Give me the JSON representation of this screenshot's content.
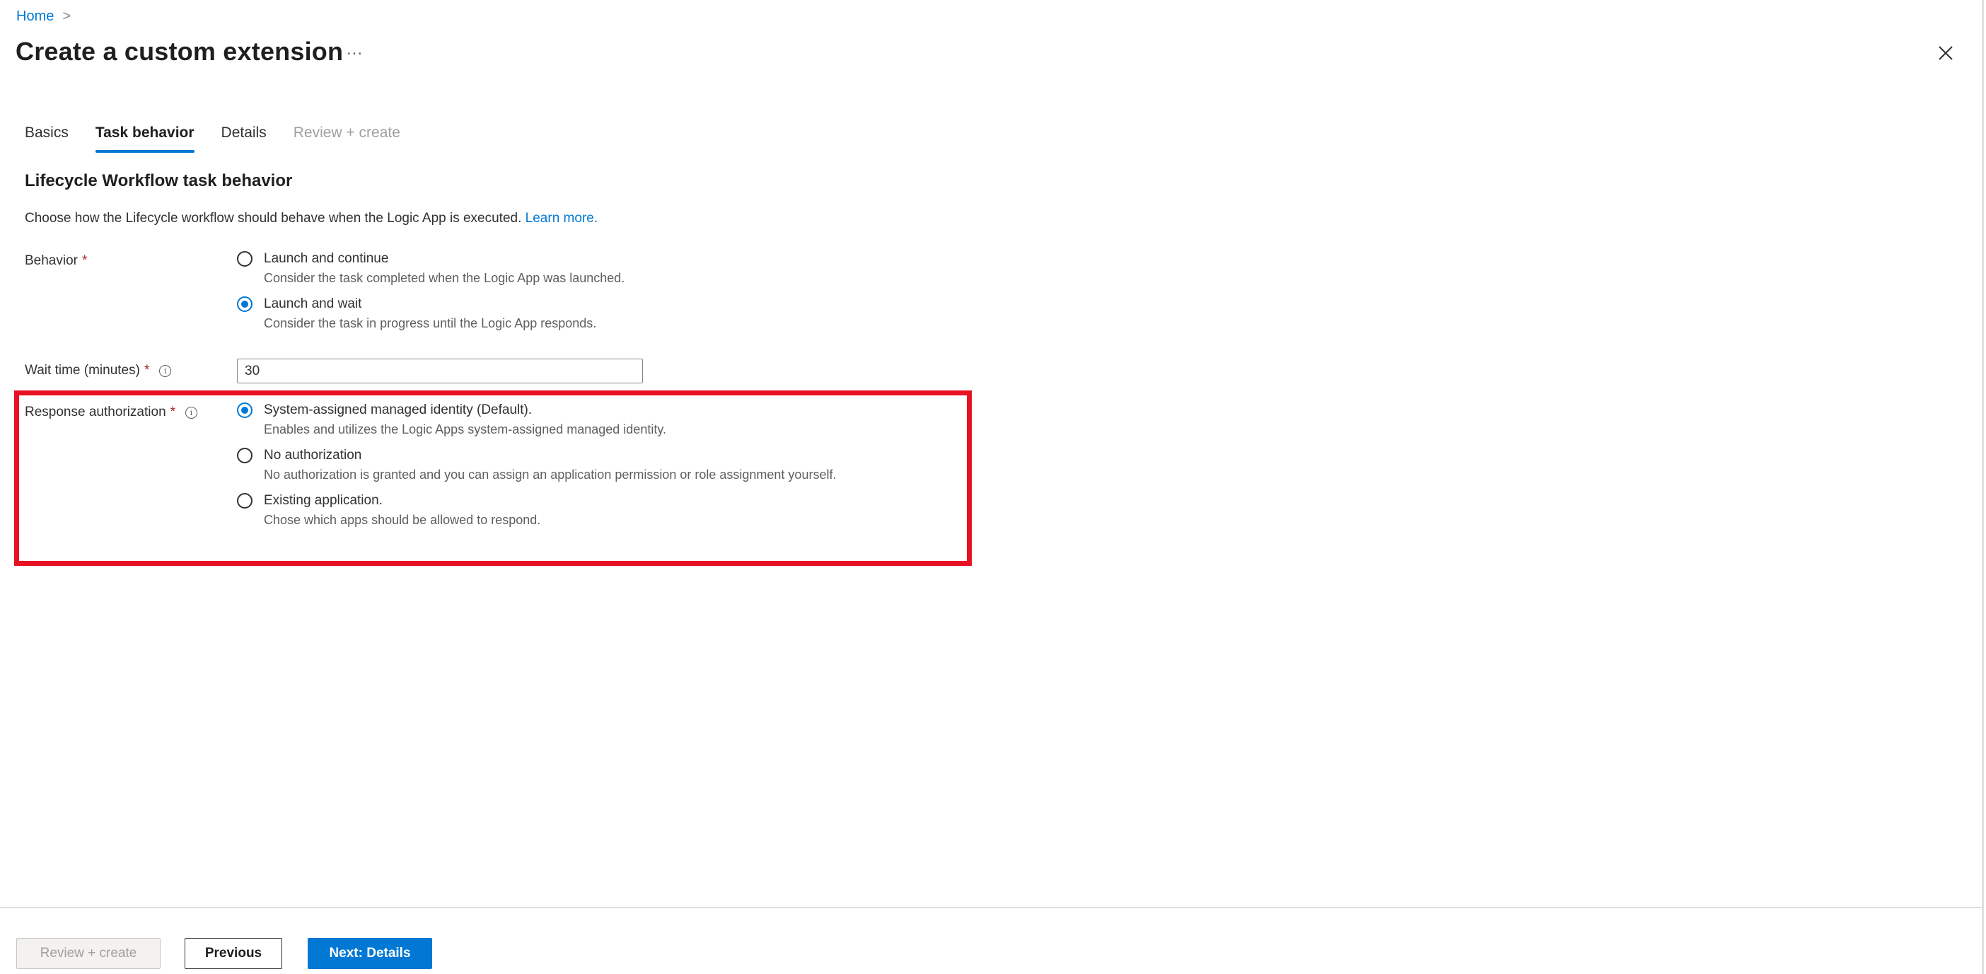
{
  "breadcrumb": {
    "home_label": "Home",
    "separator": ">"
  },
  "header": {
    "title": "Create a custom extension",
    "more_label": "...",
    "close_icon": "close-icon"
  },
  "tabs": [
    {
      "label": "Basics",
      "state": "default"
    },
    {
      "label": "Task behavior",
      "state": "active"
    },
    {
      "label": "Details",
      "state": "default"
    },
    {
      "label": "Review + create",
      "state": "disabled"
    }
  ],
  "section": {
    "title": "Lifecycle Workflow task behavior",
    "intro": "Choose how the Lifecycle workflow should behave when the Logic App is executed.",
    "learn_more": "Learn more."
  },
  "behavior": {
    "label": "Behavior",
    "required_mark": "*",
    "options": [
      {
        "label": "Launch and continue",
        "description": "Consider the task completed when the Logic App was launched.",
        "selected": false
      },
      {
        "label": "Launch and wait",
        "description": "Consider the task in progress until the Logic App responds.",
        "selected": true
      }
    ]
  },
  "wait_time": {
    "label": "Wait time (minutes)",
    "required_mark": "*",
    "info_icon": "info-icon",
    "value": "30"
  },
  "response_authorization": {
    "label": "Response authorization",
    "required_mark": "*",
    "info_icon": "info-icon",
    "highlight_color": "#e81123",
    "options": [
      {
        "label": "System-assigned managed identity (Default).",
        "description": "Enables and utilizes the Logic Apps system-assigned managed identity.",
        "selected": true
      },
      {
        "label": "No authorization",
        "description": "No authorization is granted and you can assign an application permission or role assignment yourself.",
        "selected": false
      },
      {
        "label": "Existing application.",
        "description": "Chose which apps should be allowed to respond.",
        "selected": false
      }
    ]
  },
  "footer": {
    "review_create_label": "Review + create",
    "previous_label": "Previous",
    "next_label": "Next: Details"
  },
  "colors": {
    "accent": "#0078d4",
    "required": "#a4262c",
    "highlight": "#e81123",
    "disabled_text": "#a19f9d"
  }
}
